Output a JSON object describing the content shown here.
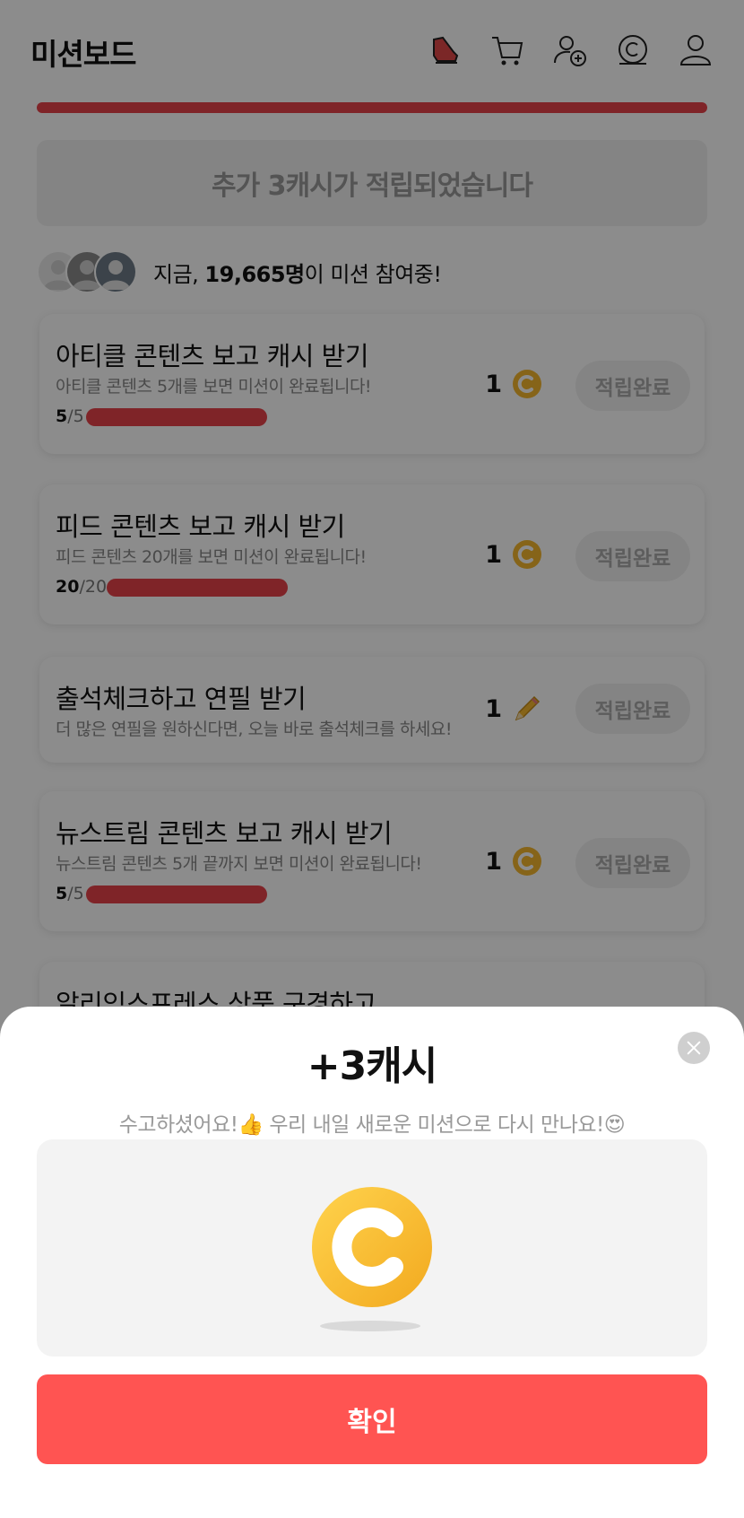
{
  "header": {
    "title": "미션보드",
    "icons": [
      "shoe-icon",
      "cart-icon",
      "add-friend-icon",
      "cash-icon",
      "profile-icon"
    ]
  },
  "notice": {
    "text": "추가 3캐시가 적립되었습니다"
  },
  "participants": {
    "prefix": "지금, ",
    "count": "19,665명",
    "suffix": "이 미션 참여중!"
  },
  "missions": [
    {
      "title": "아티클 콘텐츠 보고 캐시 받기",
      "desc": "아티클 콘텐츠 5개를 보면 미션이 완료됩니다!",
      "done": "5",
      "total": "/5",
      "progress": 1.0,
      "reward": "1",
      "reward_icon": "cash-coin-icon",
      "button": "적립완료"
    },
    {
      "title": "피드 콘텐츠 보고 캐시 받기",
      "desc": "피드 콘텐츠 20개를 보면 미션이 완료됩니다!",
      "done": "20",
      "total": "/20",
      "progress": 1.0,
      "reward": "1",
      "reward_icon": "cash-coin-icon",
      "button": "적립완료"
    },
    {
      "title": "출석체크하고 연필 받기",
      "desc": "더 많은 연필을 원하신다면, 오늘 바로 출석체크를 하세요!",
      "reward": "1",
      "reward_icon": "pencil-icon",
      "button": "적립완료"
    },
    {
      "title": "뉴스트림 콘텐츠 보고 캐시 받기",
      "desc": "뉴스트림 콘텐츠 5개 끝까지 보면 미션이 완료됩니다!",
      "done": "5",
      "total": "/5",
      "progress": 1.0,
      "reward": "1",
      "reward_icon": "cash-coin-icon",
      "button": "적립완료"
    },
    {
      "title": "알리익스프레스 상품 구경하고"
    }
  ],
  "sheet": {
    "title": "+3캐시",
    "subtitle": "수고하셨어요!👍 우리 내일 새로운 미션으로 다시 만나요!😍",
    "confirm": "확인"
  },
  "colors": {
    "accent": "#e8434a",
    "confirm": "#ff5452",
    "coin": "#f5b72e"
  }
}
